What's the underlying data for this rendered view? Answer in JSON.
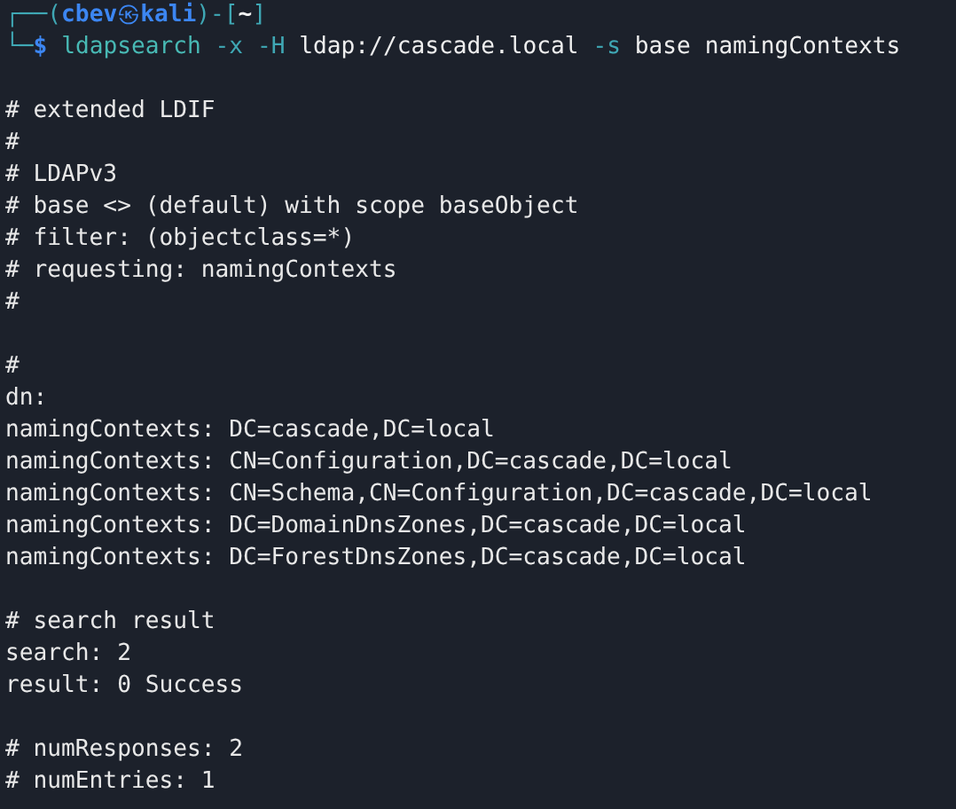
{
  "prompt": {
    "parts": [
      {
        "kind": "frame",
        "text": "┌──("
      },
      {
        "kind": "user",
        "text": "cbev"
      },
      {
        "kind": "at",
        "text": "㉿"
      },
      {
        "kind": "user",
        "text": "kali"
      },
      {
        "kind": "frame",
        "text": ")-["
      },
      {
        "kind": "dir",
        "text": "~"
      },
      {
        "kind": "frame",
        "text": "]"
      }
    ]
  },
  "command": {
    "parts": [
      {
        "kind": "frame",
        "text": "└─"
      },
      {
        "kind": "symbol",
        "text": "$"
      },
      {
        "kind": "cmd",
        "text": "ldapsearch"
      },
      {
        "kind": "option",
        "text": "-x"
      },
      {
        "kind": "option",
        "text": "-H"
      },
      {
        "kind": "arg",
        "text": "ldap://cascade.local"
      },
      {
        "kind": "option",
        "text": "-s"
      },
      {
        "kind": "arg",
        "text": "base"
      },
      {
        "kind": "arg",
        "text": "namingContexts"
      }
    ]
  },
  "output": [
    {
      "kind": "blank"
    },
    {
      "kind": "text",
      "text": "# extended LDIF"
    },
    {
      "kind": "text",
      "text": "#"
    },
    {
      "kind": "text",
      "text": "# LDAPv3"
    },
    {
      "kind": "text",
      "text": "# base <> (default) with scope baseObject"
    },
    {
      "kind": "text",
      "text": "# filter: (objectclass=*)"
    },
    {
      "kind": "text",
      "text": "# requesting: namingContexts"
    },
    {
      "kind": "text",
      "text": "#"
    },
    {
      "kind": "blank"
    },
    {
      "kind": "text",
      "text": "#"
    },
    {
      "kind": "text",
      "text": "dn:"
    },
    {
      "kind": "text",
      "text": "namingContexts: DC=cascade,DC=local"
    },
    {
      "kind": "text",
      "text": "namingContexts: CN=Configuration,DC=cascade,DC=local"
    },
    {
      "kind": "text",
      "text": "namingContexts: CN=Schema,CN=Configuration,DC=cascade,DC=local"
    },
    {
      "kind": "text",
      "text": "namingContexts: DC=DomainDnsZones,DC=cascade,DC=local"
    },
    {
      "kind": "text",
      "text": "namingContexts: DC=ForestDnsZones,DC=cascade,DC=local"
    },
    {
      "kind": "blank"
    },
    {
      "kind": "text",
      "text": "# search result"
    },
    {
      "kind": "text",
      "text": "search: 2"
    },
    {
      "kind": "text",
      "text": "result: 0 Success"
    },
    {
      "kind": "blank"
    },
    {
      "kind": "text",
      "text": "# numResponses: 2"
    },
    {
      "kind": "text",
      "text": "# numEntries: 1"
    }
  ]
}
